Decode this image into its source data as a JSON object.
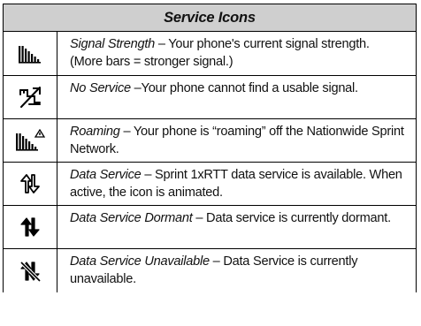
{
  "header": {
    "title": "Service Icons"
  },
  "rows": [
    {
      "icon": "signal-strength-icon",
      "term": "Signal Strength",
      "description": " – Your phone's current signal strength. (More bars = stronger signal.)"
    },
    {
      "icon": "no-service-icon",
      "term": "No Service",
      "description": " –Your phone cannot find a usable signal."
    },
    {
      "icon": "roaming-icon",
      "term": "Roaming",
      "description": " – Your phone is “roaming” off the Nationwide Sprint Network."
    },
    {
      "icon": "data-service-icon",
      "term": "Data Service",
      "description": " – Sprint 1xRTT data service is available. When active, the icon is animated."
    },
    {
      "icon": "data-service-dormant-icon",
      "term": "Data Service Dormant",
      "description": " – Data service is currently dormant."
    },
    {
      "icon": "data-service-unavailable-icon",
      "term": "Data Service Unavailable",
      "description": " – Data Service is currently unavailable."
    }
  ]
}
